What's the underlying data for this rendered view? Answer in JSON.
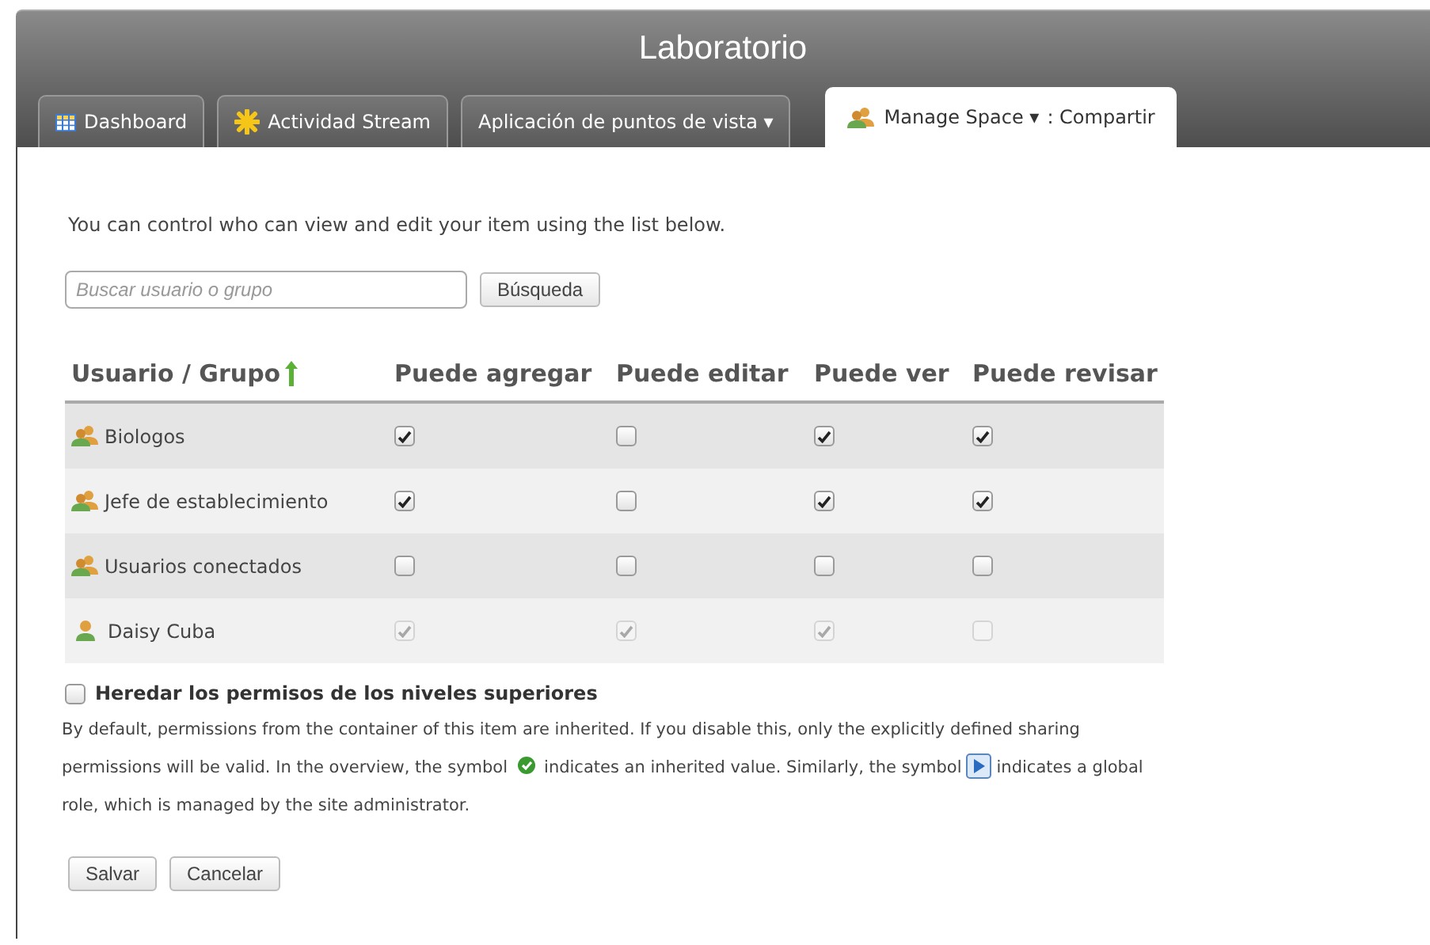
{
  "window": {
    "title": "Laboratorio"
  },
  "tabs": [
    {
      "label": "Dashboard",
      "kind": "grid",
      "selected": false
    },
    {
      "label": "Actividad Stream",
      "kind": "burst",
      "selected": false
    },
    {
      "label": "Aplicación de puntos de vista ▾",
      "kind": "plain",
      "selected": false
    },
    {
      "label": "Manage Space ▾",
      "suffix": ": Compartir",
      "kind": "people",
      "selected": true
    }
  ],
  "intro": "You can control who can view and edit your item using the list below.",
  "search": {
    "placeholder": "Buscar usuario o grupo",
    "button": "Búsqueda"
  },
  "table": {
    "columns": [
      "Usuario / Grupo",
      "Puede agregar",
      "Puede editar",
      "Puede ver",
      "Puede revisar"
    ],
    "rows": [
      {
        "name": "Biologos",
        "kind": "group",
        "disabled": false,
        "permissions": [
          true,
          false,
          true,
          true
        ]
      },
      {
        "name": "Jefe de establecimiento",
        "kind": "group",
        "disabled": false,
        "permissions": [
          true,
          false,
          true,
          true
        ]
      },
      {
        "name": "Usuarios conectados",
        "kind": "group",
        "disabled": false,
        "permissions": [
          false,
          false,
          false,
          false
        ]
      },
      {
        "name": "Daisy Cuba",
        "kind": "user",
        "disabled": true,
        "permissions": [
          true,
          true,
          true,
          false
        ]
      }
    ]
  },
  "inherit": {
    "label": "Heredar los permisos de los niveles superiores",
    "checked": false
  },
  "note": [
    "By default, permissions from the container of this item are inherited. If you disable this, only the explicitly defined sharing",
    "permissions will be valid. In the overview, the symbol",
    "indicates an inherited value. Similarly, the symbol",
    "indicates a global",
    "role, which is managed by the site administrator."
  ],
  "buttons": [
    "Salvar",
    "Cancelar"
  ]
}
